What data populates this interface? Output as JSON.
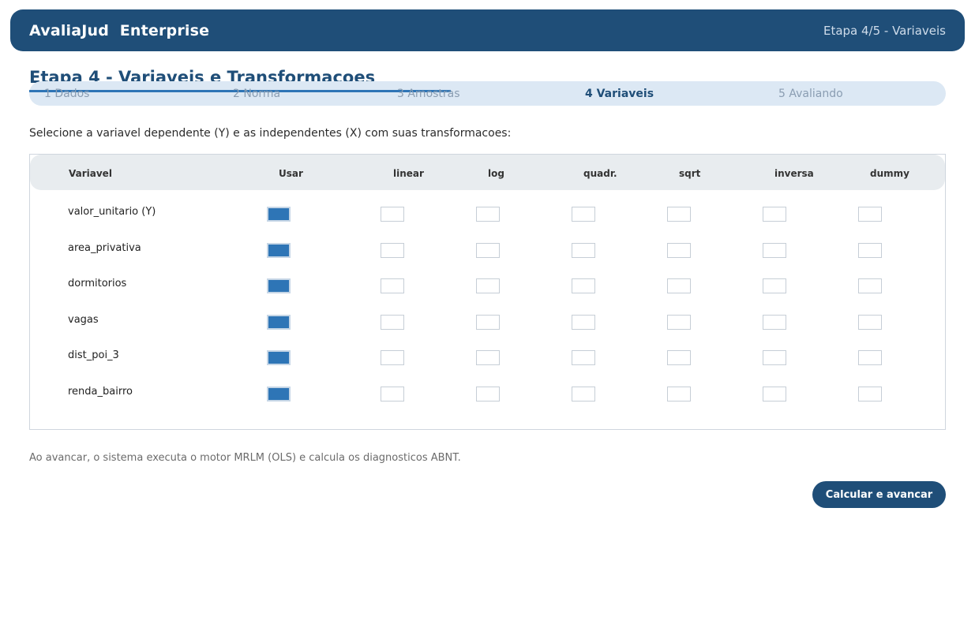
{
  "header": {
    "app_title": "AvaliaJud  Enterprise",
    "stage": "Etapa 4/5 - Variaveis"
  },
  "page_title": "Etapa 4 - Variaveis e Transformacoes",
  "stepper": {
    "progress_fraction": 0.46,
    "steps": [
      {
        "label": "1 Dados",
        "active": false
      },
      {
        "label": "2 Norma",
        "active": false
      },
      {
        "label": "3 Amostras",
        "active": false
      },
      {
        "label": "4 Variaveis",
        "active": true
      },
      {
        "label": "5 Avaliando",
        "active": false
      }
    ]
  },
  "instruction": "Selecione a variavel dependente (Y) e as independentes (X) com suas transformacoes:",
  "table": {
    "headers": [
      "Variavel",
      "Usar",
      "linear",
      "log",
      "quadr.",
      "sqrt",
      "inversa",
      "dummy"
    ],
    "rows": [
      {
        "name": "valor_unitario (Y)",
        "checks": [
          true,
          false,
          false,
          false,
          false,
          false,
          false
        ]
      },
      {
        "name": "area_privativa",
        "checks": [
          true,
          false,
          false,
          false,
          false,
          false,
          false
        ]
      },
      {
        "name": "dormitorios",
        "checks": [
          true,
          false,
          false,
          false,
          false,
          false,
          false
        ]
      },
      {
        "name": "vagas",
        "checks": [
          true,
          false,
          false,
          false,
          false,
          false,
          false
        ]
      },
      {
        "name": "dist_poi_3",
        "checks": [
          true,
          false,
          false,
          false,
          false,
          false,
          false
        ]
      },
      {
        "name": "renda_bairro",
        "checks": [
          true,
          false,
          false,
          false,
          false,
          false,
          false
        ]
      }
    ]
  },
  "footnote": "Ao avancar, o sistema executa o motor MRLM (OLS) e calcula os diagnosticos ABNT.",
  "submit_label": "Calcular e avancar",
  "colors": {
    "primary": "#1f4e78",
    "accent": "#2e75b6",
    "stepper_bg": "#dce8f4",
    "table_header_bg": "#e8ecef"
  }
}
